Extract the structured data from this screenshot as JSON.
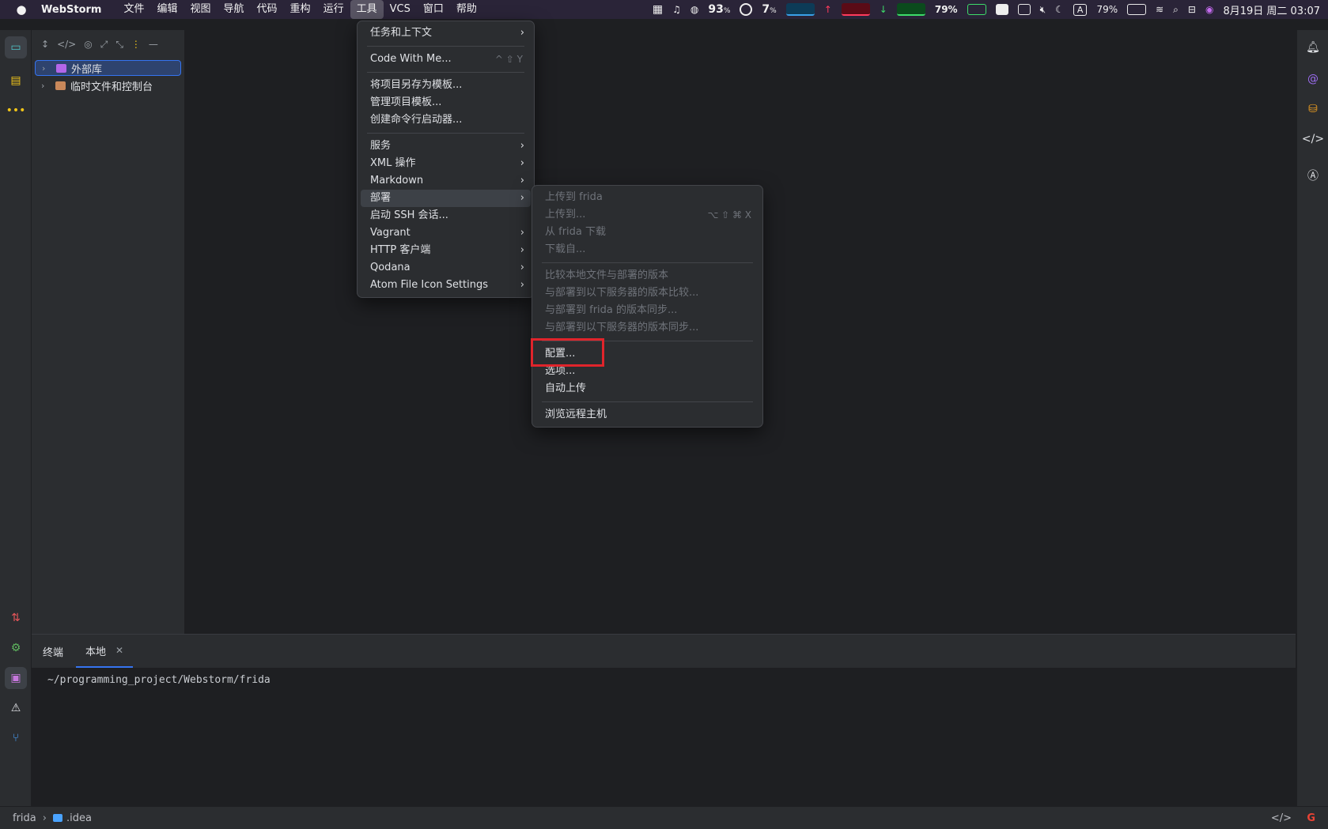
{
  "menubar": {
    "app": "WebStorm",
    "items": [
      "文件",
      "编辑",
      "视图",
      "导航",
      "代码",
      "重构",
      "运行",
      "工具",
      "VCS",
      "窗口",
      "帮助"
    ],
    "active_index": 7,
    "cpu": "93",
    "cpu_unit": "%",
    "mem": "7",
    "mem_unit": "%",
    "battery_left": "79%",
    "battery_right": "79%",
    "input_method": "A",
    "datetime": "8月19日 周二 03:07"
  },
  "project": {
    "items": [
      {
        "label": "外部库",
        "selected": true
      },
      {
        "label": "临时文件和控制台",
        "selected": false
      }
    ]
  },
  "tools_menu": [
    {
      "label": "任务和上下文",
      "submenu": true
    },
    {
      "sep": true
    },
    {
      "label": "Code With Me...",
      "shortcut": "^ ⇧ Y"
    },
    {
      "sep": true
    },
    {
      "label": "将项目另存为模板..."
    },
    {
      "label": "管理项目模板..."
    },
    {
      "label": "创建命令行启动器..."
    },
    {
      "sep": true
    },
    {
      "label": "服务",
      "submenu": true
    },
    {
      "label": "XML 操作",
      "submenu": true
    },
    {
      "label": "Markdown",
      "submenu": true
    },
    {
      "label": "部署",
      "submenu": true,
      "hover": true
    },
    {
      "label": "启动 SSH 会话..."
    },
    {
      "label": "Vagrant",
      "submenu": true
    },
    {
      "label": "HTTP 客户端",
      "submenu": true
    },
    {
      "label": "Qodana",
      "submenu": true
    },
    {
      "label": "Atom File Icon Settings",
      "submenu": true
    }
  ],
  "deploy_menu": [
    {
      "label": "上传到 frida",
      "disabled": true
    },
    {
      "label": "上传到...",
      "disabled": true,
      "shortcut": "⌥ ⇧ ⌘ X"
    },
    {
      "label": "从 frida 下载",
      "disabled": true
    },
    {
      "label": "下载自...",
      "disabled": true
    },
    {
      "sep": true
    },
    {
      "label": "比较本地文件与部署的版本",
      "disabled": true
    },
    {
      "label": "与部署到以下服务器的版本比较...",
      "disabled": true
    },
    {
      "label": "与部署到 frida 的版本同步...",
      "disabled": true
    },
    {
      "label": "与部署到以下服务器的版本同步...",
      "disabled": true
    },
    {
      "sep": true
    },
    {
      "label": "配置...",
      "highlighted": true
    },
    {
      "label": "选项..."
    },
    {
      "label": "自动上传"
    },
    {
      "sep": true
    },
    {
      "label": "浏览远程主机"
    }
  ],
  "terminal": {
    "title": "终端",
    "tab": "本地",
    "cwd": "~/programming_project/Webstorm/frida"
  },
  "statusbar": {
    "project": "frida",
    "folder": ".idea"
  },
  "colors": {
    "accent": "#3574f0",
    "highlight": "#e0242b",
    "menubar": "#2a2438"
  }
}
